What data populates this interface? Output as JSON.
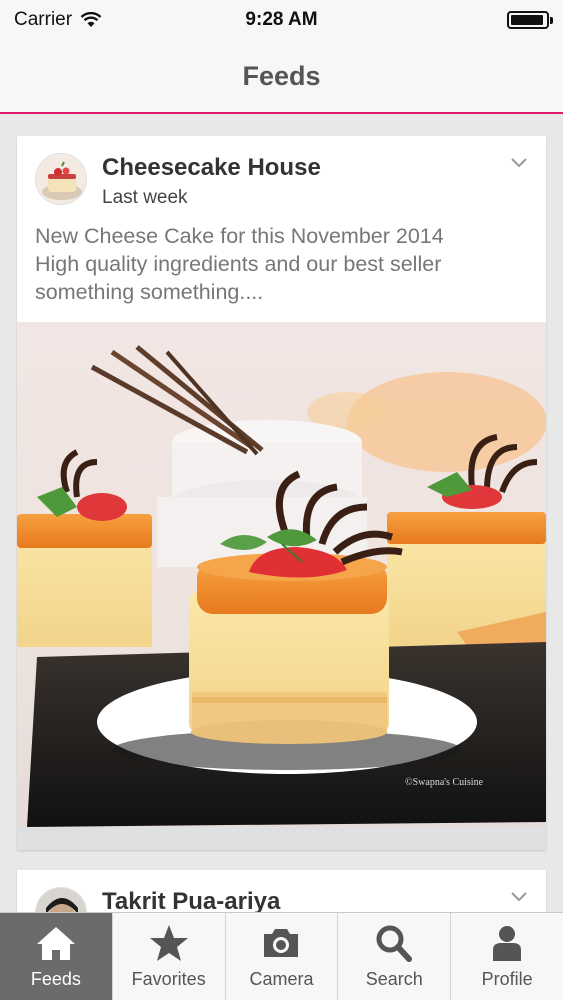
{
  "status": {
    "carrier": "Carrier",
    "time": "9:28 AM",
    "battery_level": 0.95
  },
  "nav": {
    "title": "Feeds"
  },
  "feed": [
    {
      "author": "Cheesecake House",
      "time": "Last week",
      "text_lines": [
        "New Cheese Cake for this November 2014",
        "High quality ingredients and our best seller",
        "something something...."
      ],
      "image_watermark": "©Swapna's Cuisine"
    },
    {
      "author": "Takrit Pua-ariya"
    }
  ],
  "tabs": [
    {
      "label": "Feeds",
      "icon": "home-icon",
      "active": true
    },
    {
      "label": "Favorites",
      "icon": "star-icon",
      "active": false
    },
    {
      "label": "Camera",
      "icon": "camera-icon",
      "active": false
    },
    {
      "label": "Search",
      "icon": "search-icon",
      "active": false
    },
    {
      "label": "Profile",
      "icon": "profile-icon",
      "active": false
    }
  ],
  "colors": {
    "accent": "#e0176e",
    "tab_active": "#6b6b6b"
  }
}
